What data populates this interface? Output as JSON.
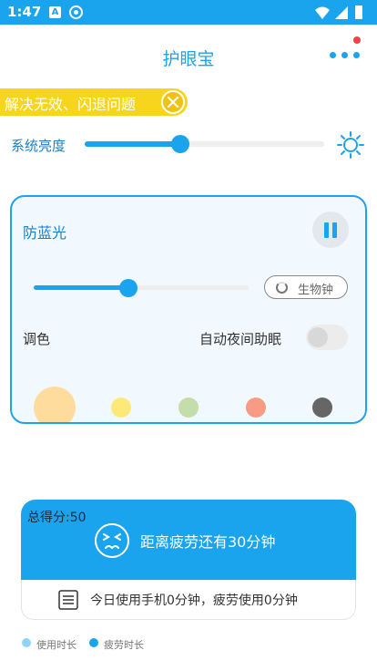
{
  "status": {
    "time": "1:47",
    "icon_a_letter": "A"
  },
  "header": {
    "title": "护眼宝"
  },
  "banner": {
    "text": "解决无效、闪退问题"
  },
  "brightness": {
    "label": "系统亮度",
    "level_percent": 40
  },
  "blue_light": {
    "title": "防蓝光",
    "filter_level_percent": 44,
    "bio_clock_label": "生物钟",
    "tint_label": "调色",
    "night_mode_label": "自动夜间助眠",
    "night_mode_on": false,
    "swatches": [
      "#fedc9d",
      "#fde978",
      "#c5dcab",
      "#f79b84",
      "#666666"
    ]
  },
  "fatigue": {
    "score_label": "总得分:50",
    "message": "距离疲劳还有30分钟",
    "usage_text": "今日使用手机0分钟，疲劳使用0分钟"
  },
  "legend": {
    "items": [
      {
        "label": "使用时长",
        "color": "#8fd3f8"
      },
      {
        "label": "疲劳时长",
        "color": "#1aa4ee"
      }
    ]
  },
  "colors": {
    "accent": "#1aa4ee",
    "banner": "#f7d51d",
    "notification": "#f2434a"
  }
}
